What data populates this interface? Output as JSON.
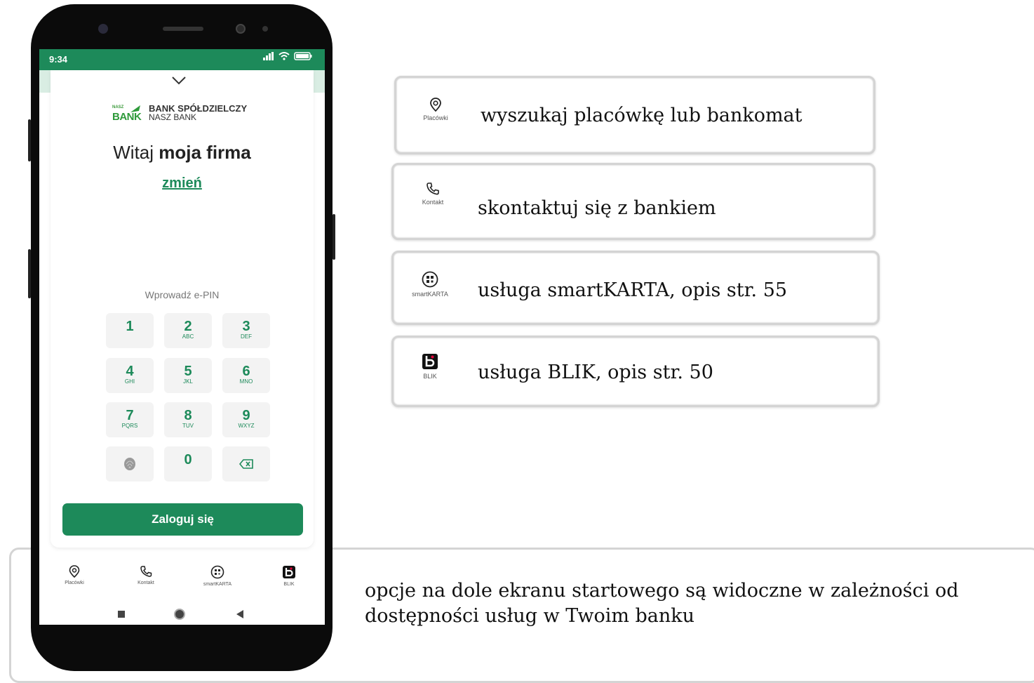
{
  "phone": {
    "status_time": "9:34",
    "bank_name_line1": "BANK SPÓŁDZIELCZY",
    "bank_name_line2": "NASZ BANK",
    "logo_small_top": "NASZ",
    "logo_big": "BANK",
    "welcome_prefix": "Witaj ",
    "welcome_name": "moja firma",
    "change_link": "zmień",
    "pin_label": "Wprowadź e-PIN",
    "keys": [
      {
        "digit": "1",
        "letters": ""
      },
      {
        "digit": "2",
        "letters": "ABC"
      },
      {
        "digit": "3",
        "letters": "DEF"
      },
      {
        "digit": "4",
        "letters": "GHI"
      },
      {
        "digit": "5",
        "letters": "JKL"
      },
      {
        "digit": "6",
        "letters": "MNO"
      },
      {
        "digit": "7",
        "letters": "PQRS"
      },
      {
        "digit": "8",
        "letters": "TUV"
      },
      {
        "digit": "9",
        "letters": "WXYZ"
      },
      {
        "digit": "0",
        "letters": ""
      }
    ],
    "login_button": "Zaloguj się",
    "nav": [
      {
        "label": "Placówki",
        "icon": "location-pin-icon"
      },
      {
        "label": "Kontakt",
        "icon": "phone-icon"
      },
      {
        "label": "smartKARTA",
        "icon": "smartkarta-icon"
      },
      {
        "label": "BLIK",
        "icon": "blik-icon"
      }
    ]
  },
  "callouts": [
    {
      "icon_label": "Placówki",
      "text": "wyszukaj placówkę lub bankomat"
    },
    {
      "icon_label": "Kontakt",
      "text": "skontaktuj się z bankiem"
    },
    {
      "icon_label": "smartKARTA",
      "text": "usługa smartKARTA, opis str. 55"
    },
    {
      "icon_label": "BLIK",
      "text": "usługa BLIK, opis str. 50"
    }
  ],
  "bottom_note": "opcje na dole ekranu startowego są widoczne w zależności od dostępności usług w Twoim banku",
  "colors": {
    "brand_green": "#1d8a5a"
  }
}
